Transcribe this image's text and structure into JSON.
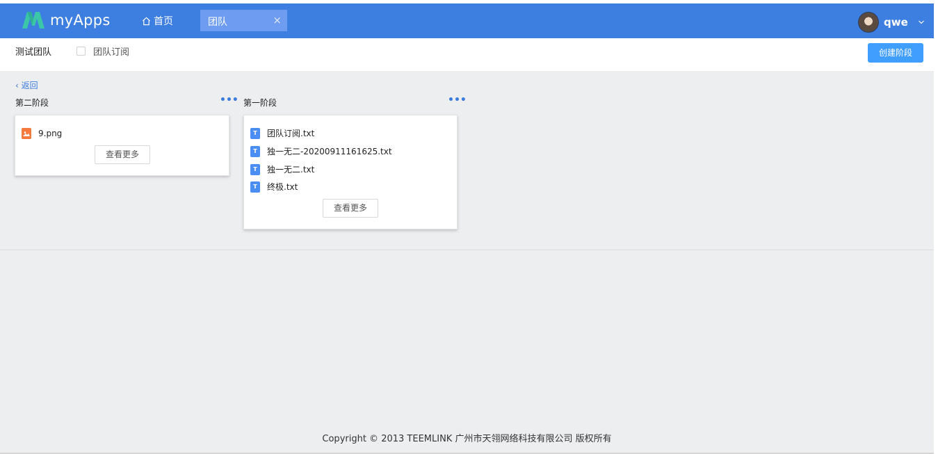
{
  "app": {
    "name": "myApps",
    "brand_color": "#3d7ee1",
    "accent_color": "#409eff"
  },
  "nav": {
    "home_label": "首页",
    "home_icon": "home-icon",
    "tab_label": "团队",
    "tab_close": "×"
  },
  "user": {
    "name": "qwe"
  },
  "subheader": {
    "team_name": "测试团队",
    "subscribe_label": "团队订阅",
    "create_stage_label": "创建阶段"
  },
  "content": {
    "back_label": "返回",
    "stages": [
      {
        "title": "第二阶段",
        "files": [
          {
            "name": "9.png",
            "type": "image"
          }
        ],
        "more_label": "查看更多"
      },
      {
        "title": "第一阶段",
        "files": [
          {
            "name": "团队订阅.txt",
            "type": "text"
          },
          {
            "name": "独一无二-20200911161625.txt",
            "type": "text"
          },
          {
            "name": "独一无二.txt",
            "type": "text"
          },
          {
            "name": "终极.txt",
            "type": "text"
          }
        ],
        "more_label": "查看更多"
      }
    ],
    "stage_menu_glyph": "•••",
    "txt_icon_letter": "T"
  },
  "footer": {
    "copyright": "Copyright © 2013 TEEMLINK 广州市天翎网络科技有限公司 版权所有"
  }
}
